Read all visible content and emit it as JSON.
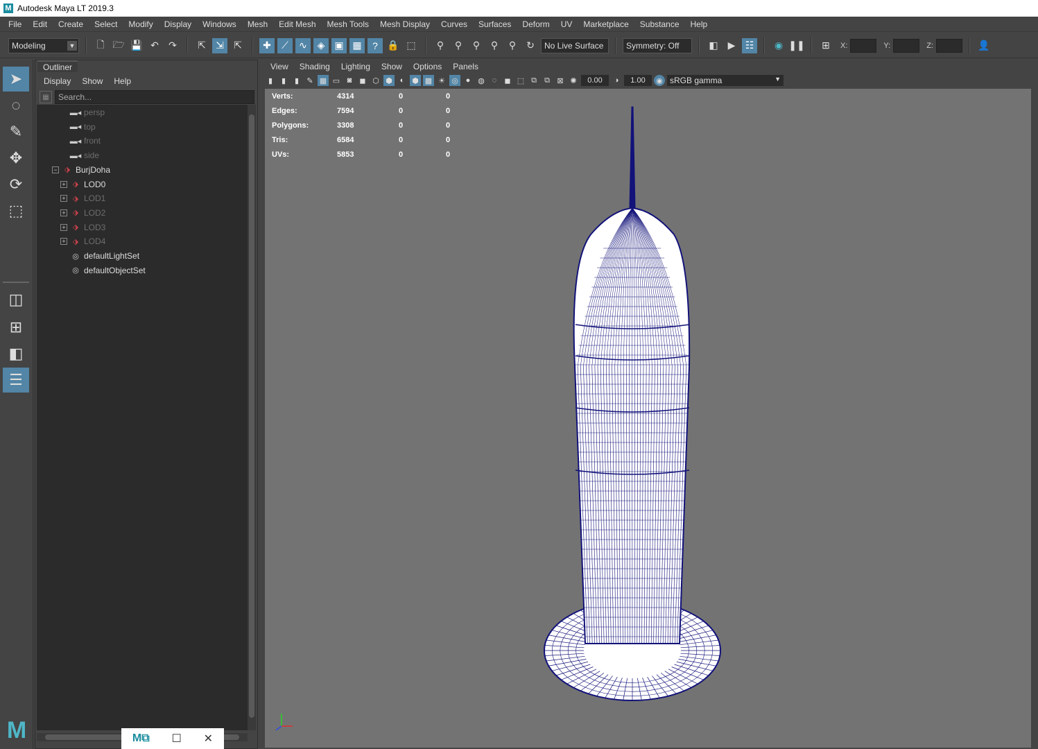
{
  "app": {
    "title": "Autodesk Maya LT 2019.3",
    "logo_letter": "M"
  },
  "menubar": [
    "File",
    "Edit",
    "Create",
    "Select",
    "Modify",
    "Display",
    "Windows",
    "Mesh",
    "Edit Mesh",
    "Mesh Tools",
    "Mesh Display",
    "Curves",
    "Surfaces",
    "Deform",
    "UV",
    "Marketplace",
    "Substance",
    "Help"
  ],
  "statusline": {
    "mode": "Modeling",
    "live_surface": "No Live Surface",
    "symmetry": "Symmetry: Off",
    "coord_labels": {
      "x": "X:",
      "y": "Y:",
      "z": "Z:"
    }
  },
  "outliner": {
    "tab": "Outliner",
    "menu": [
      "Display",
      "Show",
      "Help"
    ],
    "search_placeholder": "Search...",
    "items": [
      {
        "label": "persp",
        "icon": "camera-icon",
        "dim": true,
        "indent": 1
      },
      {
        "label": "top",
        "icon": "camera-icon",
        "dim": true,
        "indent": 1
      },
      {
        "label": "front",
        "icon": "camera-icon",
        "dim": true,
        "indent": 1
      },
      {
        "label": "side",
        "icon": "camera-icon",
        "dim": true,
        "indent": 1
      },
      {
        "label": "BurjDoha",
        "icon": "transform-icon",
        "dim": false,
        "indent": 0,
        "expander": "−"
      },
      {
        "label": "LOD0",
        "icon": "transform-icon",
        "dim": false,
        "indent": 1,
        "expander": "+"
      },
      {
        "label": "LOD1",
        "icon": "transform-icon",
        "dim": true,
        "indent": 1,
        "expander": "+"
      },
      {
        "label": "LOD2",
        "icon": "transform-icon",
        "dim": true,
        "indent": 1,
        "expander": "+"
      },
      {
        "label": "LOD3",
        "icon": "transform-icon",
        "dim": true,
        "indent": 1,
        "expander": "+"
      },
      {
        "label": "LOD4",
        "icon": "transform-icon",
        "dim": true,
        "indent": 1,
        "expander": "+"
      },
      {
        "label": "defaultLightSet",
        "icon": "set-icon",
        "dim": false,
        "indent": 1
      },
      {
        "label": "defaultObjectSet",
        "icon": "set-icon",
        "dim": false,
        "indent": 1
      }
    ]
  },
  "viewport": {
    "menu": [
      "View",
      "Shading",
      "Lighting",
      "Show",
      "Options",
      "Panels"
    ],
    "exposure": "0.00",
    "gamma_value": "1.00",
    "color_space": "sRGB gamma",
    "hud": [
      {
        "label": "Verts:",
        "a": "4314",
        "b": "0",
        "c": "0"
      },
      {
        "label": "Edges:",
        "a": "7594",
        "b": "0",
        "c": "0"
      },
      {
        "label": "Polygons:",
        "a": "3308",
        "b": "0",
        "c": "0"
      },
      {
        "label": "Tris:",
        "a": "6584",
        "b": "0",
        "c": "0"
      },
      {
        "label": "UVs:",
        "a": "5853",
        "b": "0",
        "c": "0"
      }
    ],
    "wire_color": "#12127a",
    "bg_color": "#737373"
  },
  "colors": {
    "accent": "#5285a6",
    "panel": "#444444",
    "field": "#2b2b2b"
  }
}
